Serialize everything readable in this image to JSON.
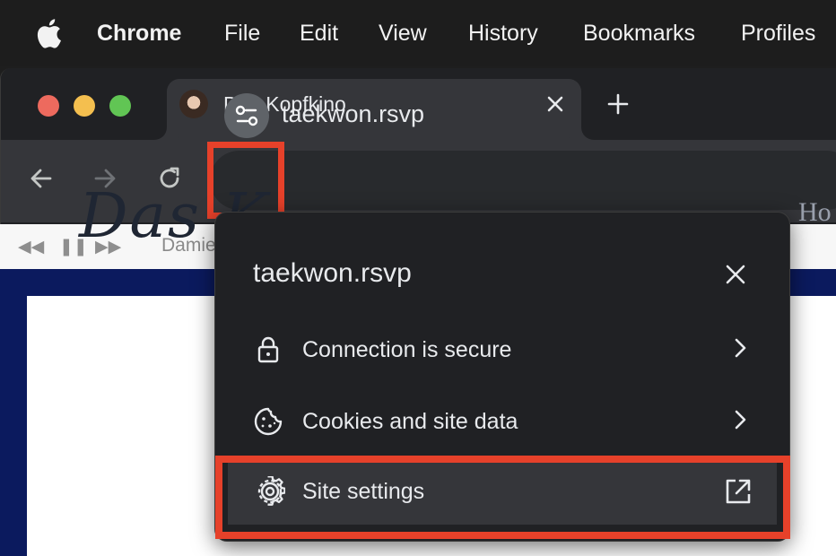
{
  "menubar": {
    "items": [
      "Chrome",
      "File",
      "Edit",
      "View",
      "History",
      "Bookmarks",
      "Profiles"
    ]
  },
  "tab": {
    "title": "Das Kopfkino"
  },
  "toolbar": {
    "url": "taekwon.rsvp"
  },
  "page": {
    "artist": "Damie",
    "logo_text": "Das K",
    "nav_partial": "Ho"
  },
  "popup": {
    "title": "taekwon.rsvp",
    "rows": [
      {
        "label": "Connection is secure",
        "icon": "lock-icon"
      },
      {
        "label": "Cookies and site data",
        "icon": "cookie-icon"
      },
      {
        "label": "Site settings",
        "icon": "gear-icon"
      }
    ]
  },
  "colors": {
    "highlight": "#e6412a",
    "popup_bg": "#202124",
    "toolbar_bg": "#35363a",
    "navy": "#0b1a5e"
  }
}
